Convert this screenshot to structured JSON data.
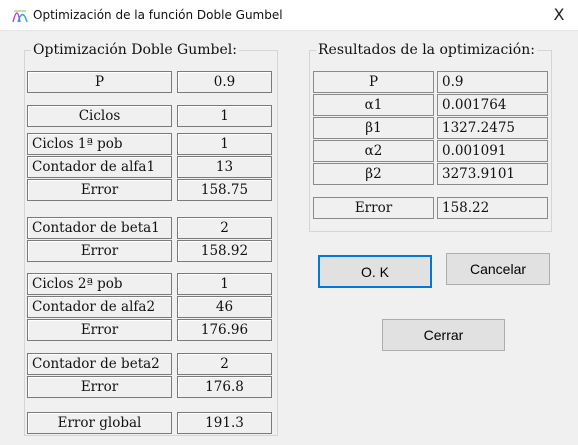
{
  "window": {
    "title": "Optimización de la función Doble Gumbel",
    "close_glyph": "X",
    "icon": "app-gumbel-icon"
  },
  "left": {
    "title": "Optimización Doble Gumbel:",
    "rows": [
      {
        "label": "P",
        "value": "0.9"
      },
      {
        "label": "Ciclos",
        "value": "1"
      },
      {
        "label": "Ciclos 1ª pob",
        "value": "1"
      },
      {
        "label": "Contador de alfa1",
        "value": "13"
      },
      {
        "label": "Error",
        "value": "158.75"
      },
      {
        "label": "Contador de beta1",
        "value": "2"
      },
      {
        "label": "Error",
        "value": "158.92"
      },
      {
        "label": "Ciclos 2ª pob",
        "value": "1"
      },
      {
        "label": "Contador de alfa2",
        "value": "46"
      },
      {
        "label": "Error",
        "value": "176.96"
      },
      {
        "label": "Contador de beta2",
        "value": "2"
      },
      {
        "label": "Error",
        "value": "176.8"
      },
      {
        "label": "Error global",
        "value": "191.3"
      }
    ]
  },
  "right": {
    "title": "Resultados de la optimización:",
    "rows": [
      {
        "label": "P",
        "value": "0.9"
      },
      {
        "label": "α1",
        "value": "0.001764"
      },
      {
        "label": "β1",
        "value": "1327.2475"
      },
      {
        "label": "α2",
        "value": "0.001091"
      },
      {
        "label": "β2",
        "value": "3273.9101"
      }
    ],
    "error": {
      "label": "Error",
      "value": "158.22"
    }
  },
  "buttons": {
    "ok": "O. K",
    "cancel": "Cancelar",
    "close": "Cerrar"
  },
  "colors": {
    "focus_border": "#0078d7",
    "client_bg": "#f0f0f0"
  }
}
